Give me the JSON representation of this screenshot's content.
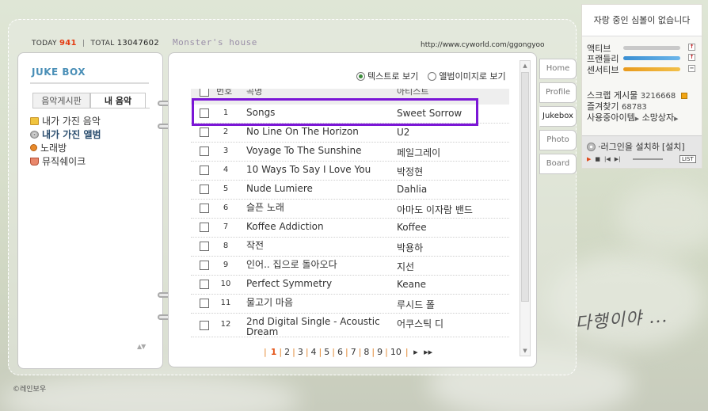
{
  "header": {
    "today_label": "TODAY",
    "today_value": "941",
    "total_label": "TOTAL",
    "total_value": "13047602",
    "home_title": "Monster's house",
    "url": "http://www.cyworld.com/ggongyoo"
  },
  "left": {
    "title": "JUKE BOX",
    "tabs": [
      {
        "label": "음악게시판",
        "active": false
      },
      {
        "label": "내 음악",
        "active": true
      }
    ],
    "menu": [
      {
        "label": "내가 가진 음악",
        "icon": "folder-icon",
        "bold": false
      },
      {
        "label": "내가 가진 앨범",
        "icon": "disc-icon",
        "bold": true
      },
      {
        "label": "노래방",
        "icon": "mic-icon",
        "bold": false
      },
      {
        "label": "뮤직쉐이크",
        "icon": "cup-icon",
        "bold": false
      }
    ]
  },
  "view_options": {
    "text_view": "텍스트로 보기",
    "album_view": "앨범이미지로 보기",
    "selected": "text_view"
  },
  "table": {
    "headers": {
      "num": "번호",
      "title": "곡명",
      "artist": "아티스트"
    },
    "rows": [
      {
        "num": "1",
        "title": "Songs",
        "artist": "Sweet Sorrow"
      },
      {
        "num": "2",
        "title": "No Line On The Horizon",
        "artist": "U2"
      },
      {
        "num": "3",
        "title": "Voyage To The Sunshine",
        "artist": "페일그레이"
      },
      {
        "num": "4",
        "title": "10 Ways To Say I Love You",
        "artist": "박정현"
      },
      {
        "num": "5",
        "title": "Nude Lumiere",
        "artist": "Dahlia"
      },
      {
        "num": "6",
        "title": "슬픈 노래",
        "artist": "아마도 이자람 밴드"
      },
      {
        "num": "7",
        "title": "Koffee Addiction",
        "artist": "Koffee"
      },
      {
        "num": "8",
        "title": "작전",
        "artist": "박용하"
      },
      {
        "num": "9",
        "title": "인어.. 집으로 돌아오다",
        "artist": "지선"
      },
      {
        "num": "10",
        "title": "Perfect Symmetry",
        "artist": "Keane"
      },
      {
        "num": "11",
        "title": "물고기 마음",
        "artist": "루시드 폴"
      },
      {
        "num": "12",
        "title": "2nd Digital Single - Acoustic Dream",
        "artist": "어쿠스틱 디"
      }
    ]
  },
  "pager": {
    "pages": [
      "1",
      "2",
      "3",
      "4",
      "5",
      "6",
      "7",
      "8",
      "9",
      "10"
    ],
    "current": "1",
    "next": "▸",
    "last": "▸▸"
  },
  "side_tabs": [
    {
      "label": "Home",
      "active": false
    },
    {
      "label": "Profile",
      "active": false
    },
    {
      "label": "Jukebox",
      "active": true
    },
    {
      "label": "Photo",
      "active": false
    },
    {
      "label": "Board",
      "active": false
    }
  ],
  "info": {
    "now_playing": "자랑 중인 심볼이 없습니다",
    "moods": [
      {
        "label": "액티브",
        "level": 0.95,
        "color": "#a7a7a7"
      },
      {
        "label": "프랜들리",
        "level": 0.95,
        "color": "#3e95d6"
      },
      {
        "label": "센서티브",
        "level": 0.95,
        "color": "#e9a320"
      }
    ],
    "scrap_label": "스크랩 게시물",
    "scrap_value": "3216668",
    "favorite_label": "즐겨찾기",
    "favorite_value": "68783",
    "items_label": "사용중아이템",
    "wish_label": "소망상자",
    "plugin_msg": "·러그인을 설치하",
    "install_label": "[설치]",
    "list_label": "LIST"
  },
  "decor": {
    "handwriting": "다행이야 ...",
    "copyright": "©레인보우"
  }
}
